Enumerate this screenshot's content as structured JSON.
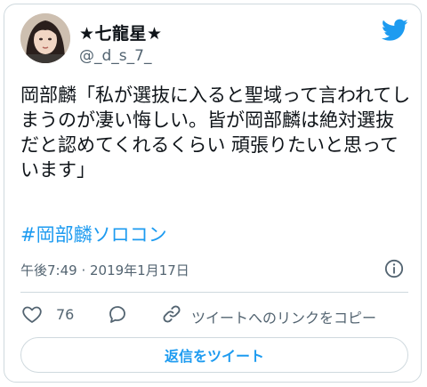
{
  "author": {
    "display_name": "★七龍星★",
    "handle": "@_d_s_7_"
  },
  "tweet": {
    "text": "岡部麟「私が選抜に入ると聖域って言われてしまうのが凄い悔しい。皆が岡部麟は絶対選抜だと認めてくれるくらい 頑張りたいと思っています」",
    "hashtag": "#岡部麟ソロコン",
    "timestamp": "午後7:49 · 2019年1月17日"
  },
  "actions": {
    "like_count": "76",
    "copy_link_label": "ツイートへのリンクをコピー",
    "reply_button_label": "返信をツイート"
  },
  "colors": {
    "accent": "#1d9bf0",
    "secondary_text": "#536471",
    "border": "#cfd9de"
  },
  "icons": [
    "twitter-bird-icon",
    "info-icon",
    "heart-icon",
    "reply-bubble-icon",
    "link-icon"
  ]
}
